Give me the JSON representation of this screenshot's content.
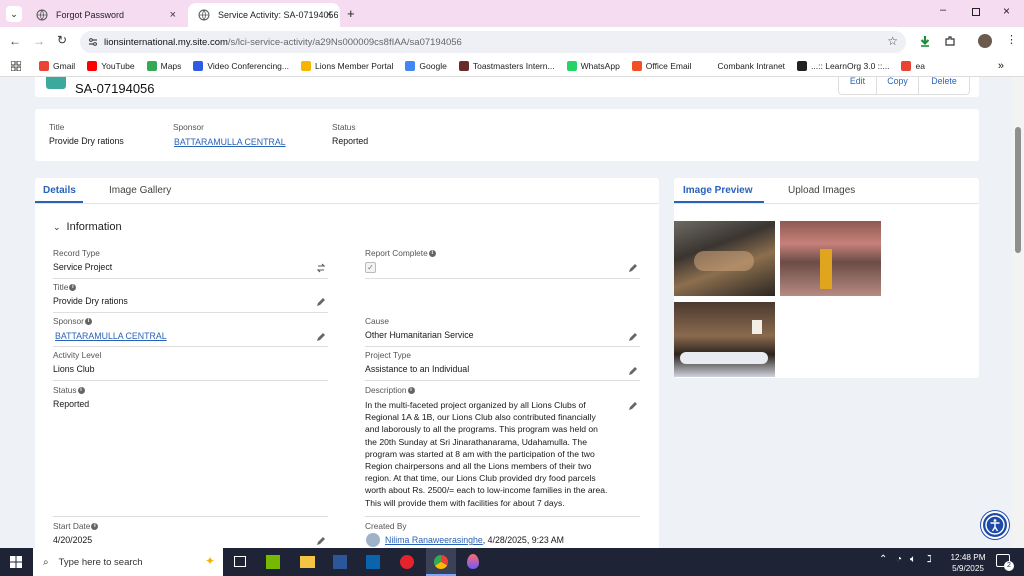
{
  "browser": {
    "tabs": [
      {
        "title": "Forgot Password"
      },
      {
        "title": "Service Activity: SA-07194056"
      }
    ],
    "url_host": "lionsinternational.my.site.com",
    "url_path": "/s/lci-service-activity/a29Ns000009cs8fIAA/sa07194056",
    "bookmarks": [
      {
        "label": "Gmail",
        "color": "#ea4335"
      },
      {
        "label": "YouTube",
        "color": "#ff0000"
      },
      {
        "label": "Maps",
        "color": "#34a853"
      },
      {
        "label": "Video Conferencing...",
        "color": "#2d5be3"
      },
      {
        "label": "Lions Member Portal",
        "color": "#f4b400"
      },
      {
        "label": "Google",
        "color": "#4285f4"
      },
      {
        "label": "Toastmasters Intern...",
        "color": "#6b2a2a"
      },
      {
        "label": "WhatsApp",
        "color": "#25d366"
      },
      {
        "label": "Office Email",
        "color": "#f25022"
      },
      {
        "label": "Combank Intranet",
        "color": "#ffffff"
      },
      {
        "label": "...:: LearnOrg 3.0 ::...",
        "color": "#222222"
      },
      {
        "label": "ea",
        "color": "#ea4335"
      }
    ]
  },
  "record": {
    "id": "SA-07194056",
    "actions": {
      "edit": "Edit",
      "copy": "Copy",
      "delete": "Delete"
    },
    "highlights": {
      "title_label": "Title",
      "title_value": "Provide Dry rations",
      "sponsor_label": "Sponsor",
      "sponsor_value": "BATTARAMULLA CENTRAL",
      "status_label": "Status",
      "status_value": "Reported"
    }
  },
  "details": {
    "tabs": {
      "details": "Details",
      "gallery": "Image Gallery"
    },
    "section": "Information",
    "left": {
      "record_type_label": "Record Type",
      "record_type_value": "Service Project",
      "title_label": "Title",
      "title_value": "Provide Dry rations",
      "sponsor_label": "Sponsor",
      "sponsor_value": "BATTARAMULLA CENTRAL",
      "activity_level_label": "Activity Level",
      "activity_level_value": "Lions Club",
      "status_label": "Status",
      "status_value": "Reported",
      "start_date_label": "Start Date",
      "start_date_value": "4/20/2025"
    },
    "right": {
      "report_complete_label": "Report Complete",
      "cause_label": "Cause",
      "cause_value": "Other Humanitarian Service",
      "project_type_label": "Project Type",
      "project_type_value": "Assistance to an Individual",
      "description_label": "Description",
      "description_lines": [
        "In the multi-faceted project organized by all Lions Clubs of",
        "Regional 1A & 1B, our Lions Club also contributed financially",
        "and laborously to all the programs. This program was held on",
        "the 20th Sunday at Sri Jinarathanarama, Udahamulla. The",
        "program was started at 8 am with the participation of the two",
        "Region chairpersons and all the Lions members of their two",
        "region. At that time, our Lions Club provided dry food parcels",
        "worth about Rs. 2500/= each to low-income families in the area.",
        "This will provide them with facilities for about 7 days."
      ],
      "created_by_label": "Created By",
      "created_by_name": "Nilima Ranaweerasinghe",
      "created_by_date": ", 4/28/2025, 9:23 AM"
    }
  },
  "images": {
    "tabs": {
      "preview": "Image Preview",
      "upload": "Upload Images"
    }
  },
  "taskbar": {
    "search": "Type here to search",
    "time": "12:48 PM",
    "date": "5/9/2025",
    "notifications": "2"
  }
}
